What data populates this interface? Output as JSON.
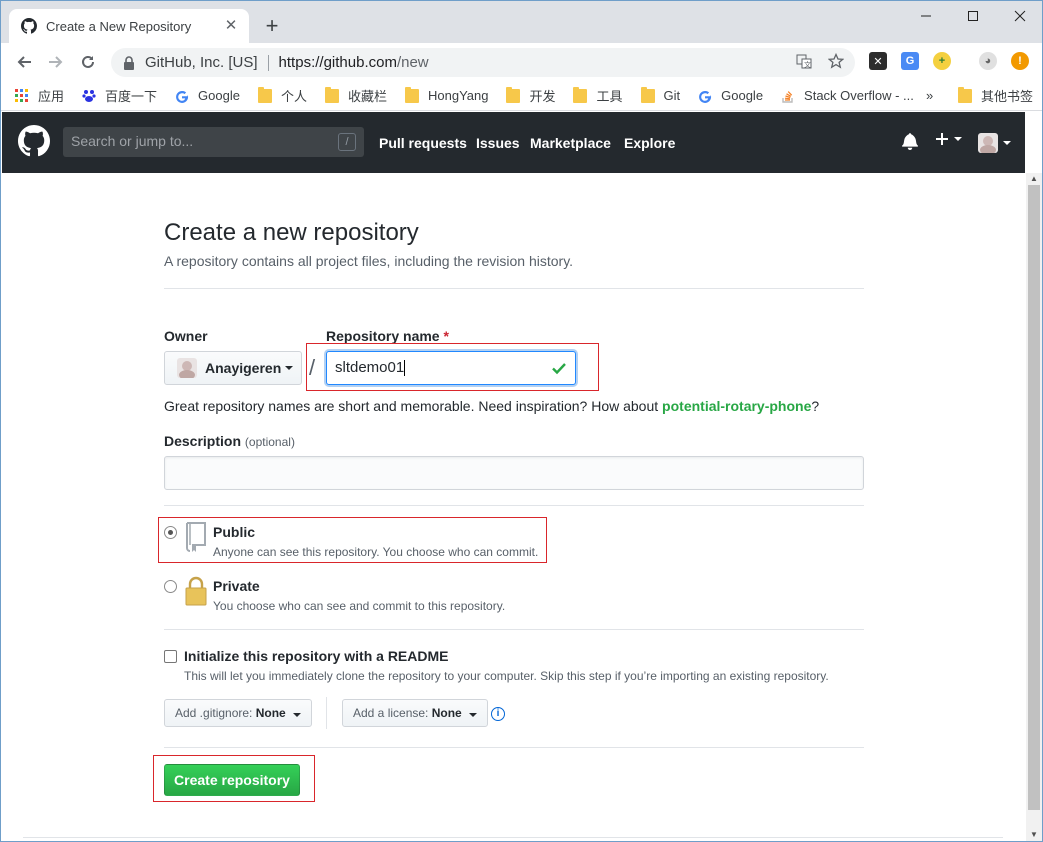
{
  "browser": {
    "tab_title": "Create a New Repository",
    "new_tab": "+",
    "omnibox_site": "GitHub, Inc. [US]",
    "url_main": "https://github.com",
    "url_path": "/new",
    "bookmarks": [
      {
        "label": "应用",
        "icon": "apps-grid-icon"
      },
      {
        "label": "百度一下",
        "icon": "baidu-paw-icon"
      },
      {
        "label": "Google",
        "icon": "google-g-icon"
      },
      {
        "label": "个人",
        "icon": "folder-icon"
      },
      {
        "label": "收藏栏",
        "icon": "folder-icon"
      },
      {
        "label": "HongYang",
        "icon": "folder-icon"
      },
      {
        "label": "开发",
        "icon": "folder-icon"
      },
      {
        "label": "工具",
        "icon": "folder-icon"
      },
      {
        "label": "Git",
        "icon": "folder-icon"
      },
      {
        "label": "Google",
        "icon": "google-g-icon"
      },
      {
        "label": "Stack Overflow - ...",
        "icon": "stackoverflow-icon"
      }
    ],
    "bookmarks_overflow": "»",
    "other_bookmarks": "其他书签"
  },
  "github": {
    "search_placeholder": "Search or jump to...",
    "search_shortcut": "/",
    "nav": [
      "Pull requests",
      "Issues",
      "Marketplace",
      "Explore"
    ]
  },
  "page": {
    "title": "Create a new repository",
    "subtitle": "A repository contains all project files, including the revision history.",
    "owner_label": "Owner",
    "owner_value": "Anayigeren",
    "repo_name_label": "Repository name",
    "required_mark": "*",
    "slash": "/",
    "repo_name_value": "sltdemo01",
    "hint_prefix": "Great repository names are short and memorable. Need inspiration? How about ",
    "hint_suggestion": "potential-rotary-phone",
    "hint_suffix": "?",
    "description_label": "Description",
    "description_optional": "(optional)",
    "public_title": "Public",
    "public_note": "Anyone can see this repository. You choose who can commit.",
    "private_title": "Private",
    "private_note": "You choose who can see and commit to this repository.",
    "readme_title": "Initialize this repository with a README",
    "readme_note": "This will let you immediately clone the repository to your computer. Skip this step if you’re importing an existing repository.",
    "gitignore_label": "Add .gitignore:",
    "gitignore_value": "None",
    "license_label": "Add a license:",
    "license_value": "None",
    "info_glyph": "i",
    "create_button": "Create repository"
  },
  "colors": {
    "header_bg": "#24292e",
    "primary_green": "#28a745",
    "annotation_red": "#d9262b",
    "focus_blue": "#2188ff"
  }
}
